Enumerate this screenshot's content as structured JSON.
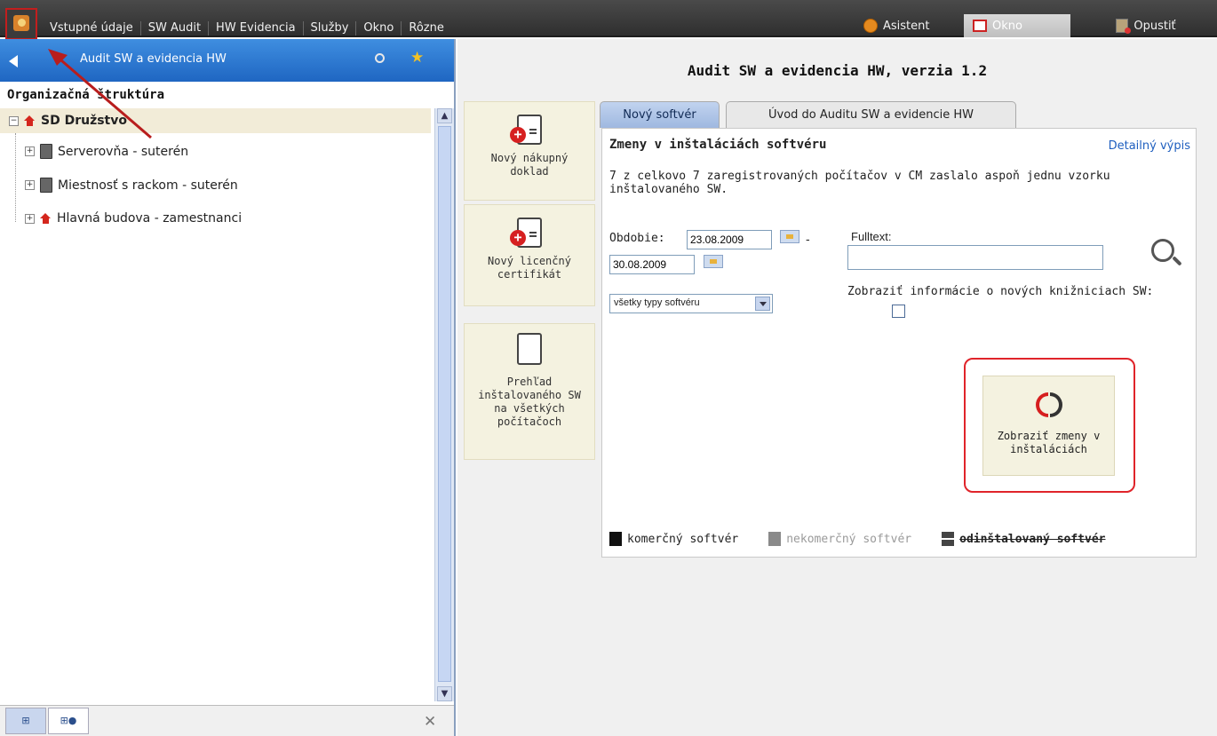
{
  "menubar": {
    "items": [
      "Vstupné údaje",
      "SW Audit",
      "HW Evidencia",
      "Služby",
      "Okno",
      "Rôzne"
    ],
    "asistent_label": "Asistent",
    "okno_label": "Okno",
    "opustit_label": "Opustiť"
  },
  "left_panel": {
    "title": "Audit SW a evidencia HW",
    "section_label": "Organizačná štruktúra",
    "tree": [
      {
        "label": "SD Družstvo",
        "icon": "house-icon"
      },
      {
        "label": "Serverovňa - suterén",
        "icon": "server-icon"
      },
      {
        "label": "Miestnosť s rackom - suterén",
        "icon": "server-icon"
      },
      {
        "label": "Hlavná budova - zamestnanci",
        "icon": "house-icon"
      }
    ]
  },
  "main": {
    "title": "Audit SW a evidencia HW, verzia 1.2",
    "tiles": {
      "purchase": "Nový nákupný doklad",
      "license": "Nový licenčný certifikát",
      "overview": "Prehľad inštalovaného SW na všetkých počítačoch"
    },
    "tabs": {
      "new_software": "Nový softvér",
      "intro": "Úvod do Auditu SW a evidencie HW"
    },
    "section_title": "Zmeny v inštaláciách softvéru",
    "detail_link": "Detailný výpis",
    "info_text": "7 z celkovo 7 zaregistrovaných počítačov v CM zaslalo aspoň jednu vzorku inštalovaného SW.",
    "period_label": "Obdobie:",
    "date_from": "23.08.2009",
    "date_to": "30.08.2009",
    "type_select": "všetky typy softvéru",
    "fulltext_label": "Fulltext:",
    "fulltext_value": "",
    "new_libraries_label": "Zobraziť informácie o nových knižniciach SW:",
    "show_changes_label": "Zobraziť zmeny v inštaláciách",
    "legend": {
      "commercial": "komerčný softvér",
      "noncommercial": "nekomerčný softvér",
      "uninstalled": "odinštalovaný softvér"
    }
  }
}
